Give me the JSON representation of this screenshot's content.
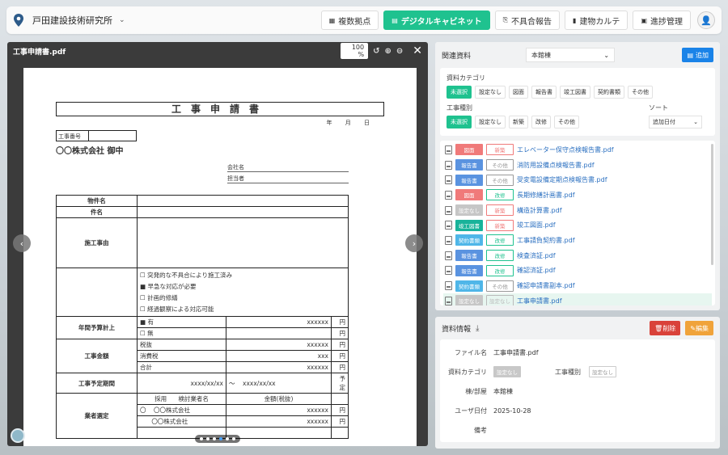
{
  "header": {
    "org_name": "戸田建設技術研究所",
    "nav": [
      {
        "label": "複数拠点",
        "icon": "multi-site-icon",
        "active": false
      },
      {
        "label": "デジタルキャビネット",
        "icon": "document-icon",
        "active": true
      },
      {
        "label": "不具合報告",
        "icon": "report-icon",
        "active": false
      },
      {
        "label": "建物カルテ",
        "icon": "chart-icon",
        "active": false
      },
      {
        "label": "進捗管理",
        "icon": "calendar-icon",
        "active": false
      }
    ]
  },
  "viewer": {
    "file_name": "工事申請書.pdf",
    "zoom": "100 %",
    "page_dots": 6,
    "current_dot": 3
  },
  "doc": {
    "title": "工事申請書",
    "date_line": "年 月 日",
    "koji_no_label": "工事番号",
    "atena": "〇〇株式会社 御中",
    "company_label": "会社名",
    "tanto_label": "担当者",
    "bukken": "物件名",
    "kenmei": "件名",
    "riyu": "施工事由",
    "checks": [
      "突発的な不具合により施工済み",
      "早急な対応が必要",
      "計画的修繕",
      "経過観察による対応可能"
    ],
    "checks_mark": [
      "☐",
      "■",
      "☐",
      "☐"
    ],
    "nenkan": "年間予算計上",
    "ari": "有",
    "nashi": "無",
    "ari_mark": "■",
    "nashi_mark": "☐",
    "amount_x": "xxxxxx",
    "yen": "円",
    "kingaku": "工事金額",
    "zeinuki": "税抜",
    "shohizei": "消費税",
    "gokei": "合計",
    "zei_x": "xxx",
    "yotei": "工事予定期間",
    "date_from": "xxxx/xx/xx",
    "tilde": "〜",
    "date_to": "xxxx/xx/xx",
    "yotei_suffix": "予定",
    "gyosha": "業者選定",
    "saiyo": "採用",
    "kento": "検討業者名",
    "kingaku_zeinuki": "金額(税抜)",
    "maru": "〇",
    "vendor": "〇〇株式会社"
  },
  "related": {
    "title": "関連資料",
    "building": "本館棟",
    "add_label": "追加",
    "category_label": "資料カテゴリ",
    "categories": [
      "未選択",
      "設定なし",
      "図面",
      "報告書",
      "竣工図書",
      "契約書類",
      "その他"
    ],
    "kind_label": "工事種別",
    "kinds": [
      "未選択",
      "設定なし",
      "新築",
      "改修",
      "その他"
    ],
    "sort_label": "ソート",
    "sort_value": "追加日付",
    "files": [
      {
        "cat": "図面",
        "cat_color": "#f07a7a",
        "kind": "新築",
        "kind_color": "#f07a7a",
        "name": "エレベーター保守点検報告書.pdf"
      },
      {
        "cat": "報告書",
        "cat_color": "#5a93e0",
        "kind": "その他",
        "kind_color": "#999999",
        "name": "消防用設備点検報告書.pdf"
      },
      {
        "cat": "報告書",
        "cat_color": "#5a93e0",
        "kind": "その他",
        "kind_color": "#999999",
        "name": "受変電設備定期点検報告書.pdf"
      },
      {
        "cat": "図面",
        "cat_color": "#f07a7a",
        "kind": "改修",
        "kind_color": "#1fc28f",
        "name": "長期修繕計画書.pdf"
      },
      {
        "cat": "設定なし",
        "cat_color": "#c6c6c6",
        "kind": "新築",
        "kind_color": "#f07a7a",
        "name": "構造計算書.pdf"
      },
      {
        "cat": "竣工図書",
        "cat_color": "#19b39a",
        "kind": "新築",
        "kind_color": "#f07a7a",
        "name": "竣工図面.pdf"
      },
      {
        "cat": "契約書類",
        "cat_color": "#4fb6e8",
        "kind": "改修",
        "kind_color": "#1fc28f",
        "name": "工事請負契約書.pdf"
      },
      {
        "cat": "報告書",
        "cat_color": "#5a93e0",
        "kind": "改修",
        "kind_color": "#1fc28f",
        "name": "検査済証.pdf"
      },
      {
        "cat": "報告書",
        "cat_color": "#5a93e0",
        "kind": "改修",
        "kind_color": "#1fc28f",
        "name": "確認済証.pdf"
      },
      {
        "cat": "契約書類",
        "cat_color": "#4fb6e8",
        "kind": "その他",
        "kind_color": "#999999",
        "name": "確認申請書副本.pdf"
      },
      {
        "cat": "設定なし",
        "cat_color": "#c6c6c6",
        "kind": "設定なし",
        "kind_color": "#bbbbbb",
        "name": "工事申請書.pdf",
        "selected": true
      }
    ]
  },
  "info": {
    "title": "資料情報",
    "delete_label": "削除",
    "edit_label": "編集",
    "file_name_label": "ファイル名",
    "file_name": "工事申請書.pdf",
    "category_label": "資料カテゴリ",
    "category": "設定なし",
    "kind_label": "工事種別",
    "kind": "設定なし",
    "room_label": "棟/部屋",
    "room": "本館棟",
    "date_label": "ユーザ日付",
    "date": "2025-10-28",
    "memo_label": "備考"
  }
}
